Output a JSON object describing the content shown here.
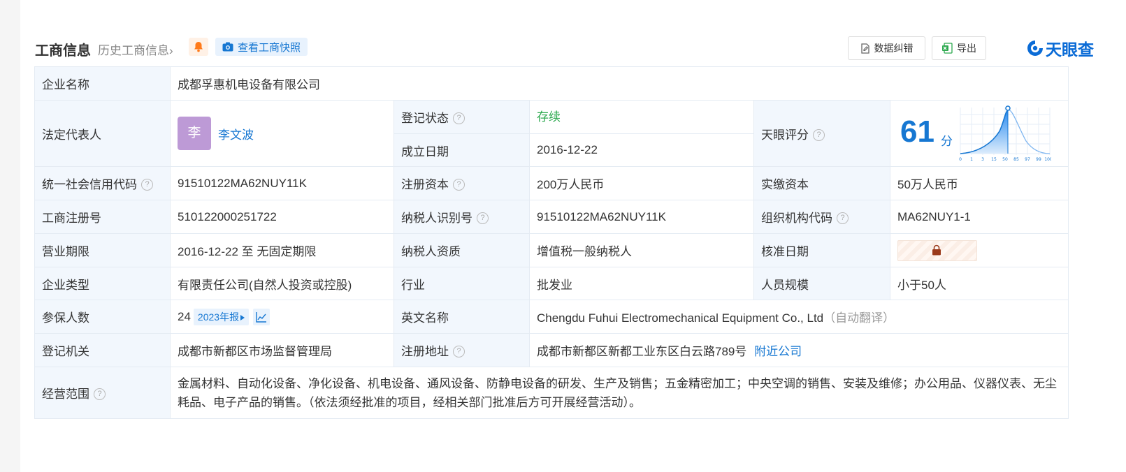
{
  "header": {
    "title": "工商信息",
    "history_link": "历史工商信息",
    "history_chevron": "›",
    "snapshot_button": "查看工商快照",
    "correct_button": "数据纠错",
    "export_button": "导出",
    "logo_text": "天眼查"
  },
  "rows": {
    "company_name_label": "企业名称",
    "company_name": "成都孚惠机电设备有限公司",
    "legal_rep_label": "法定代表人",
    "legal_rep_avatar": "李",
    "legal_rep_name": "李文波",
    "reg_status_label": "登记状态",
    "reg_status": "存续",
    "est_date_label": "成立日期",
    "est_date": "2016-12-22",
    "score_label": "天眼评分",
    "score_value": "61",
    "score_unit": "分",
    "score_ticks": [
      "0",
      "1",
      "3",
      "15",
      "50",
      "85",
      "97",
      "99",
      "100"
    ],
    "credit_code_label": "统一社会信用代码",
    "credit_code": "91510122MA62NUY11K",
    "reg_capital_label": "注册资本",
    "reg_capital": "200万人民币",
    "paid_capital_label": "实缴资本",
    "paid_capital": "50万人民币",
    "biz_reg_no_label": "工商注册号",
    "biz_reg_no": "510122000251722",
    "taxpayer_id_label": "纳税人识别号",
    "taxpayer_id": "91510122MA62NUY11K",
    "org_code_label": "组织机构代码",
    "org_code": "MA62NUY1-1",
    "term_label": "营业期限",
    "term": "2016-12-22 至 无固定期限",
    "taxpayer_qual_label": "纳税人资质",
    "taxpayer_qual": "增值税一般纳税人",
    "approve_date_label": "核准日期",
    "company_type_label": "企业类型",
    "company_type": "有限责任公司(自然人投资或控股)",
    "industry_label": "行业",
    "industry": "批发业",
    "staff_size_label": "人员规模",
    "staff_size": "小于50人",
    "insured_label": "参保人数",
    "insured": "24",
    "insured_report": "2023年报",
    "en_name_label": "英文名称",
    "en_name": "Chengdu Fuhui Electromechanical Equipment Co., Ltd",
    "en_name_note": "（自动翻译）",
    "authority_label": "登记机关",
    "authority": "成都市新都区市场监督管理局",
    "address_label": "注册地址",
    "address": "成都市新都区新都工业东区白云路789号",
    "nearby_link": "附近公司",
    "scope_label": "经营范围",
    "scope": "金属材料、自动化设备、净化设备、机电设备、通风设备、防静电设备的研发、生产及销售；五金精密加工；中央空调的销售、安装及维修；办公用品、仪器仪表、无尘耗品、电子产品的销售。（依法须经批准的项目，经相关部门批准后方可开展经营活动）。"
  },
  "colors": {
    "accent": "#1677d2",
    "status_green": "#2da94f",
    "label_bg": "#f2f7fd",
    "avatar_bg": "#bd9ad6"
  },
  "icons": [
    "chevron-right-icon",
    "bell-icon",
    "camera-icon",
    "edit-document-icon",
    "excel-icon",
    "tianyancha-logo-icon",
    "question-icon",
    "lock-icon",
    "trend-chart-icon",
    "play-arrow-icon"
  ]
}
